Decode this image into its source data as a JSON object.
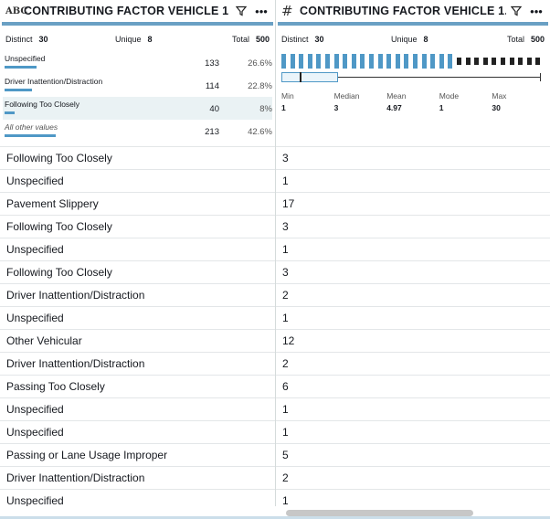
{
  "left": {
    "type_label": "ABC",
    "title": "CONTRIBUTING FACTOR VEHICLE 1",
    "stats": {
      "distinct_label": "Distinct",
      "distinct": "30",
      "unique_label": "Unique",
      "unique": "8",
      "total_label": "Total",
      "total": "500"
    },
    "profile": [
      {
        "label": "Unspecified",
        "count": "133",
        "pct": "26.6%",
        "fraction": 0.266
      },
      {
        "label": "Driver Inattention/Distraction",
        "count": "114",
        "pct": "22.8%",
        "fraction": 0.228
      },
      {
        "label": "Following Too Closely",
        "count": "40",
        "pct": "8%",
        "fraction": 0.08
      },
      {
        "label": "All other values",
        "count": "213",
        "pct": "42.6%",
        "fraction": 0.426
      }
    ]
  },
  "right": {
    "type_icon": "hash-icon",
    "title": "CONTRIBUTING FACTOR VEHICLE 1...",
    "stats": {
      "distinct_label": "Distinct",
      "distinct": "30",
      "unique_label": "Unique",
      "unique": "8",
      "total_label": "Total",
      "total": "500"
    },
    "summary": [
      {
        "label": "Min",
        "value": "1"
      },
      {
        "label": "Median",
        "value": "3"
      },
      {
        "label": "Mean",
        "value": "4.97"
      },
      {
        "label": "Mode",
        "value": "1"
      },
      {
        "label": "Max",
        "value": "30"
      }
    ]
  },
  "rows": [
    {
      "name": "Following Too Closely",
      "value": "3"
    },
    {
      "name": "Unspecified",
      "value": "1"
    },
    {
      "name": "Pavement Slippery",
      "value": "17"
    },
    {
      "name": "Following Too Closely",
      "value": "3"
    },
    {
      "name": "Unspecified",
      "value": "1"
    },
    {
      "name": "Following Too Closely",
      "value": "3"
    },
    {
      "name": "Driver Inattention/Distraction",
      "value": "2"
    },
    {
      "name": "Unspecified",
      "value": "1"
    },
    {
      "name": "Other Vehicular",
      "value": "12"
    },
    {
      "name": "Driver Inattention/Distraction",
      "value": "2"
    },
    {
      "name": "Passing Too Closely",
      "value": "6"
    },
    {
      "name": "Unspecified",
      "value": "1"
    },
    {
      "name": "Unspecified",
      "value": "1"
    },
    {
      "name": "Passing or Lane Usage Improper",
      "value": "5"
    },
    {
      "name": "Driver Inattention/Distraction",
      "value": "2"
    },
    {
      "name": "Unspecified",
      "value": "1"
    }
  ],
  "colors": {
    "accent": "#6aa0c4",
    "bar": "#4f98c6",
    "highlight": "#eaf2f4"
  }
}
